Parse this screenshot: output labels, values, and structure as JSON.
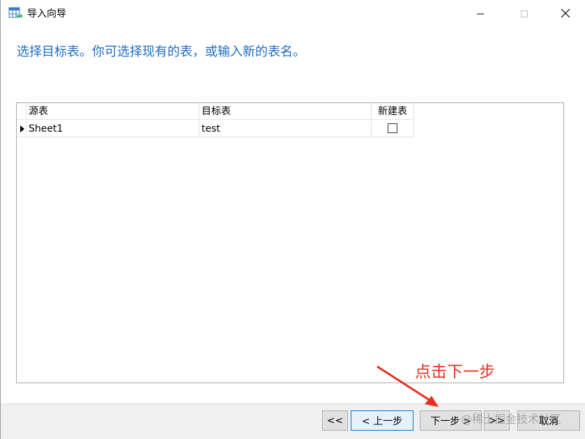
{
  "window": {
    "title": "导入向导",
    "controls": {
      "minimize_icon": "minimize-icon",
      "maximize_icon": "maximize-icon",
      "close_icon": "close-icon"
    }
  },
  "heading": "选择目标表。你可选择现有的表，或输入新的表名。",
  "grid": {
    "columns": [
      "源表",
      "目标表",
      "新建表"
    ],
    "rows": [
      {
        "source": "Sheet1",
        "target": "test",
        "new_table": false
      }
    ]
  },
  "footer": {
    "first_label": "<<",
    "prev_label": "< 上一步",
    "next_label": "下一步 >",
    "last_label": ">>",
    "cancel_label": "取消"
  },
  "annotation": {
    "text": "点击下一步",
    "color": "#e8301f"
  },
  "watermark": "@稀土掘金技术社区",
  "colors": {
    "heading": "#1c6dc4",
    "button_focus_border": "#0078d7"
  }
}
